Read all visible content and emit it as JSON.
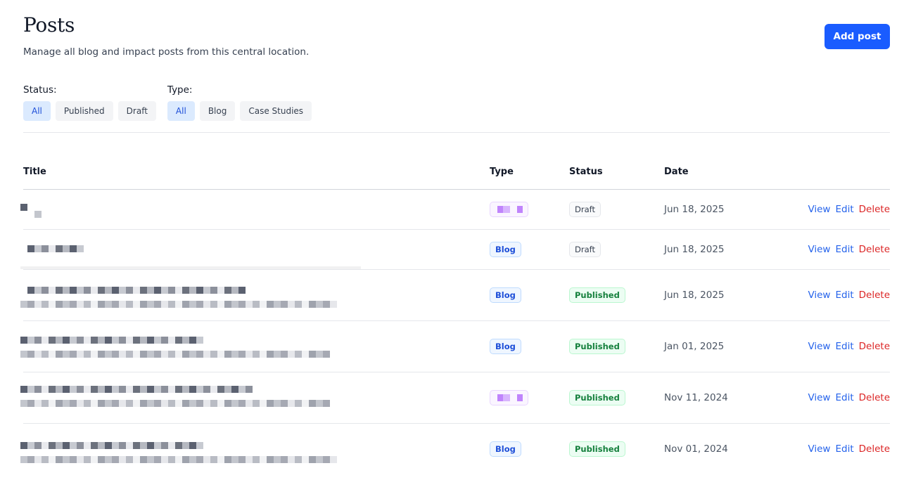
{
  "header": {
    "title": "Posts",
    "subtitle": "Manage all blog and impact posts from this central location.",
    "add_button": "Add post"
  },
  "filters": {
    "status": {
      "label": "Status:",
      "options": [
        "All",
        "Published",
        "Draft"
      ],
      "selected": "All"
    },
    "type": {
      "label": "Type:",
      "options": [
        "All",
        "Blog",
        "Case Studies"
      ],
      "selected": "All"
    }
  },
  "table": {
    "columns": {
      "title": "Title",
      "type": "Type",
      "status": "Status",
      "date": "Date"
    },
    "actions": {
      "view": "View",
      "edit": "Edit",
      "delete": "Delete"
    },
    "rows": [
      {
        "type": "",
        "status": "Draft",
        "date": "Jun 18, 2025"
      },
      {
        "type": "Blog",
        "status": "Draft",
        "date": "Jun 18, 2025"
      },
      {
        "type": "Blog",
        "status": "Published",
        "date": "Jun 18, 2025"
      },
      {
        "type": "Blog",
        "status": "Published",
        "date": "Jan 01, 2025"
      },
      {
        "type": "",
        "status": "Published",
        "date": "Nov 11, 2024"
      },
      {
        "type": "Blog",
        "status": "Published",
        "date": "Nov 01, 2024"
      }
    ]
  },
  "colors": {
    "primary": "#1a5cff",
    "link": "#2563eb",
    "danger": "#dc2626",
    "published": "#15803d",
    "blog": "#1d4ed8"
  }
}
